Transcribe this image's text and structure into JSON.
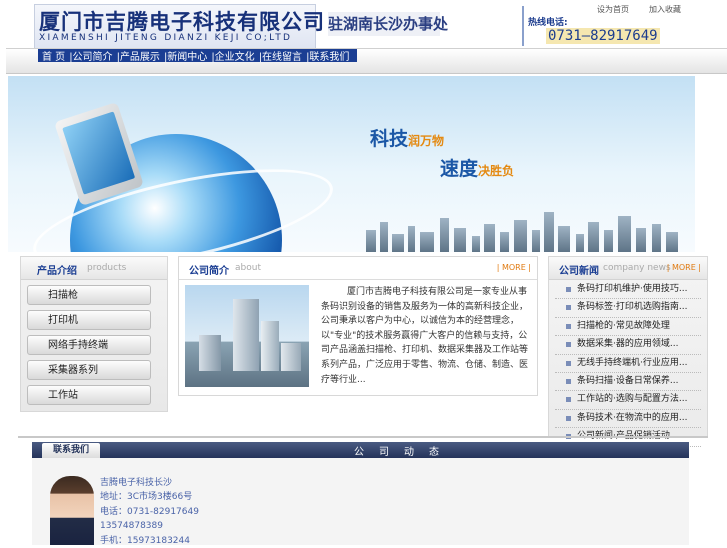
{
  "header": {
    "company_cn": "厦门市吉腾电子科技有限公司",
    "company_en": "XIAMENSHI JITENG DIANZI KEJI CO;LTD",
    "office": "驻湖南长沙办事处",
    "hotline_label": "热线电话:",
    "hotline_number": "0731—82917649",
    "set_home": "设为首页",
    "add_favorite": "加入收藏"
  },
  "nav": {
    "items": [
      "首 页",
      "|公司简介",
      "|产品展示",
      "|新闻中心",
      "|企业文化",
      "|在线留言",
      "|联系我们"
    ]
  },
  "banner": {
    "slogan1_main": "科技",
    "slogan1_accent": "润万物",
    "slogan2_main": "速度",
    "slogan2_accent": "决胜负"
  },
  "products": {
    "title_cn": "产品介绍",
    "title_en": "products",
    "items": [
      "扫描枪",
      "打印机",
      "网络手持终端",
      "采集器系列",
      "工作站"
    ]
  },
  "about": {
    "title_cn": "公司简介",
    "title_en": "about",
    "more": "| MORE |",
    "text": "厦门市吉腾电子科技有限公司是一家专业从事条码识别设备的销售及服务为一体的高新科技企业，公司秉承以客户为中心，以诚信为本的经营理念，以\"专业\"的技术服务赢得广大客户的信赖与支持，公司产品涵盖扫描枪、打印机、数据采集器及工作站等系列产品，广泛应用于零售、物流、仓储、制造、医疗等行业..."
  },
  "news": {
    "title_cn": "公司新闻",
    "title_en": "company news",
    "more": "| MORE |",
    "items": [
      "条码打印机维护·使用技巧...",
      "条码标签·打印机选购指南...",
      "扫描枪的·常见故障处理",
      "数据采集·器的应用领域...",
      "无线手持终端机·行业应用...",
      "条码扫描·设备日常保养...",
      "工作站的·选购与配置方法...",
      "条码技术·在物流中的应用...",
      "公司新闻·产品促销活动..."
    ]
  },
  "contact": {
    "tab": "联系我们",
    "center_title": "公司动态",
    "company": "吉腾电子科技长沙",
    "address": "地址：3C市场3楼66号",
    "phone": "电话：0731-82917649",
    "mobile": "13574878389",
    "mobile2": "手机：15973183244"
  },
  "colors": {
    "brand_blue": "#1b3e93",
    "accent_orange": "#e07a10",
    "link_blue": "#4a63a8"
  }
}
